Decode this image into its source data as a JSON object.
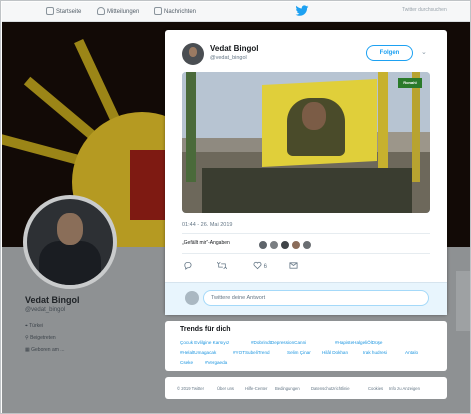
{
  "topnav": {
    "home_label": "Startseite",
    "notifications_label": "Mitteilungen",
    "messages_label": "Nachrichten",
    "search_placeholder": "Twitter durchsuchen"
  },
  "profile": {
    "name": "Vedat Bingol",
    "handle": "@vedat_bingol",
    "meta": [
      "Türkei",
      "Beigetreten",
      "Geboren am ..."
    ]
  },
  "tweet": {
    "author_name": "Vedat Bingol",
    "author_handle": "@vedat_bingol",
    "follow_label": "Folgen",
    "media_logo_text": "Ronahî",
    "timestamp": "01:44 - 26. Mai 2019",
    "like_line": "„Gefällt mir“-Angaben",
    "likers_count": 5,
    "like_count": "6",
    "reply_placeholder": "Twittere deine Antwort"
  },
  "trends": {
    "title": "Trends für dich",
    "items": [
      "Çocuk Evlilgine Karsıyız",
      "#DobrindtDepressionCanni",
      "#HapisteHalgeliÖlDüşe",
      "#HelaltUmagacak",
      "#YOTSubeliTrend",
      "Selim Çinar",
      "Hilâl Dokhan",
      "Irak hudresi",
      "Antalo",
      "Cseke",
      "#Vergaeda"
    ]
  },
  "footer": {
    "links": [
      "© 2019 Twitter",
      "Über uns",
      "Hilfe-Center",
      "Bedingungen",
      "Datenschutzrichtlinie",
      "Cookies",
      "Info zu Anzeigen"
    ]
  },
  "colors": {
    "accent": "#1da1f2",
    "link": "#1b95e0",
    "reply_bg": "#e8f5fd",
    "flag_yellow": "#e0cf3a"
  },
  "icons": [
    "home-icon",
    "bell-icon",
    "mail-icon",
    "twitter-bird-icon",
    "chevron-down-icon",
    "reply-icon",
    "retweet-icon",
    "heart-icon",
    "message-icon",
    "location-icon",
    "calendar-icon",
    "link-icon"
  ]
}
